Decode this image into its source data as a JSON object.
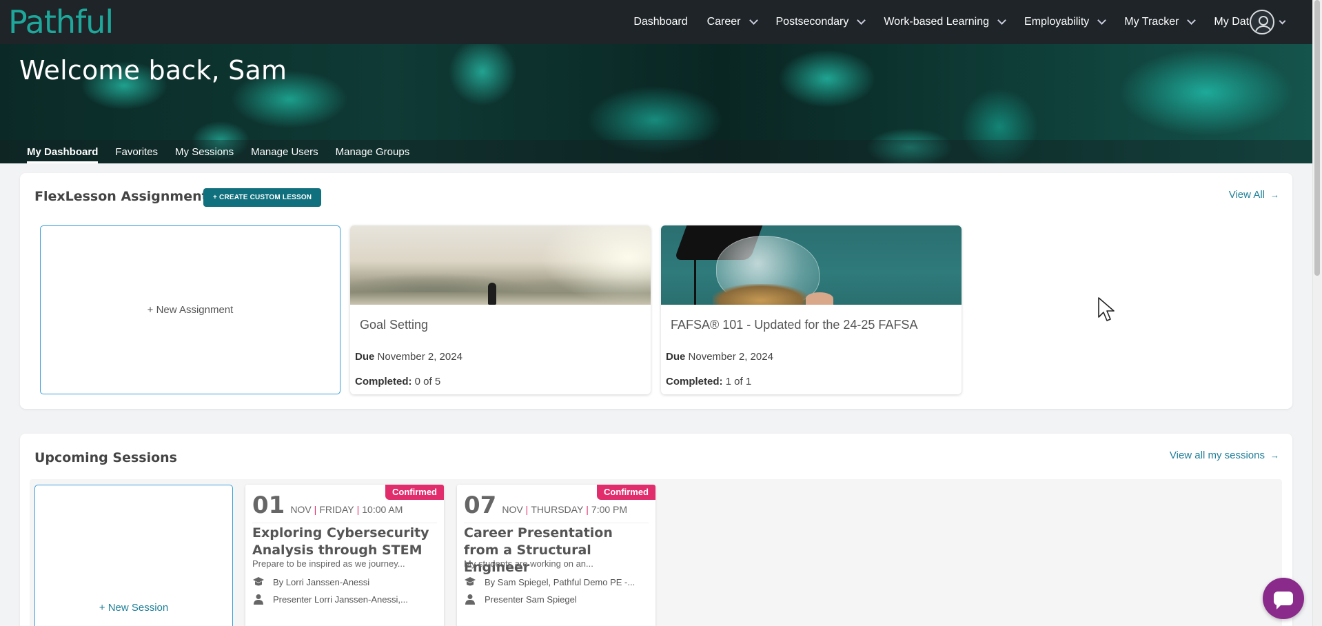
{
  "app": {
    "logo_text": "Pathful",
    "brand_color": "#1ea89c"
  },
  "nav": {
    "items": [
      {
        "label": "Dashboard",
        "has_dropdown": false
      },
      {
        "label": "Career",
        "has_dropdown": true
      },
      {
        "label": "Postsecondary",
        "has_dropdown": true
      },
      {
        "label": "Work-based Learning",
        "has_dropdown": true
      },
      {
        "label": "Employability",
        "has_dropdown": true
      },
      {
        "label": "My Tracker",
        "has_dropdown": true
      },
      {
        "label": "My Data",
        "has_dropdown": true
      }
    ],
    "avatar_icon": "user-circle-icon"
  },
  "hero": {
    "title": "Welcome back, Sam",
    "tabs": [
      {
        "label": "My Dashboard",
        "active": true
      },
      {
        "label": "Favorites",
        "active": false
      },
      {
        "label": "My Sessions",
        "active": false
      },
      {
        "label": "Manage Users",
        "active": false
      },
      {
        "label": "Manage Groups",
        "active": false
      }
    ]
  },
  "flexlessons": {
    "title": "FlexLesson Assignments",
    "create_button": "+ CREATE CUSTOM LESSON",
    "view_all": "View All",
    "new_assignment": "+ New Assignment",
    "due_label": "Due",
    "completed_label": "Completed:",
    "cards": [
      {
        "title": "Goal Setting",
        "due": "November 2, 2024",
        "completed": "0 of 5"
      },
      {
        "title": "FAFSA® 101 - Updated for the 24-25 FAFSA",
        "due": "November 2, 2024",
        "completed": "1 of 1"
      }
    ]
  },
  "sessions": {
    "title": "Upcoming Sessions",
    "view_all": "View all my sessions",
    "new_session": "+ New Session",
    "cards": [
      {
        "badge": "Confirmed",
        "day": "01",
        "month": "NOV",
        "weekday": "FRIDAY",
        "time": "10:00 AM",
        "title": "Exploring Cybersecurity Analysis through STEM",
        "description": "Prepare to be inspired as we journey...",
        "by": "By Lorri Janssen-Anessi",
        "presenter": "Presenter Lorri Janssen-Anessi,..."
      },
      {
        "badge": "Confirmed",
        "day": "07",
        "month": "NOV",
        "weekday": "THURSDAY",
        "time": "7:00 PM",
        "title": "Career Presentation from a Structural Engineer",
        "description": "My students are working on an...",
        "by": "By Sam Spiegel, Pathful Demo PE -...",
        "presenter": "Presenter Sam Spiegel"
      }
    ]
  },
  "colors": {
    "nav_bg": "#1e2428",
    "accent": "#11707d",
    "link": "#1f7f99",
    "badge": "#e22d6d",
    "chat": "#8a2a8b"
  }
}
